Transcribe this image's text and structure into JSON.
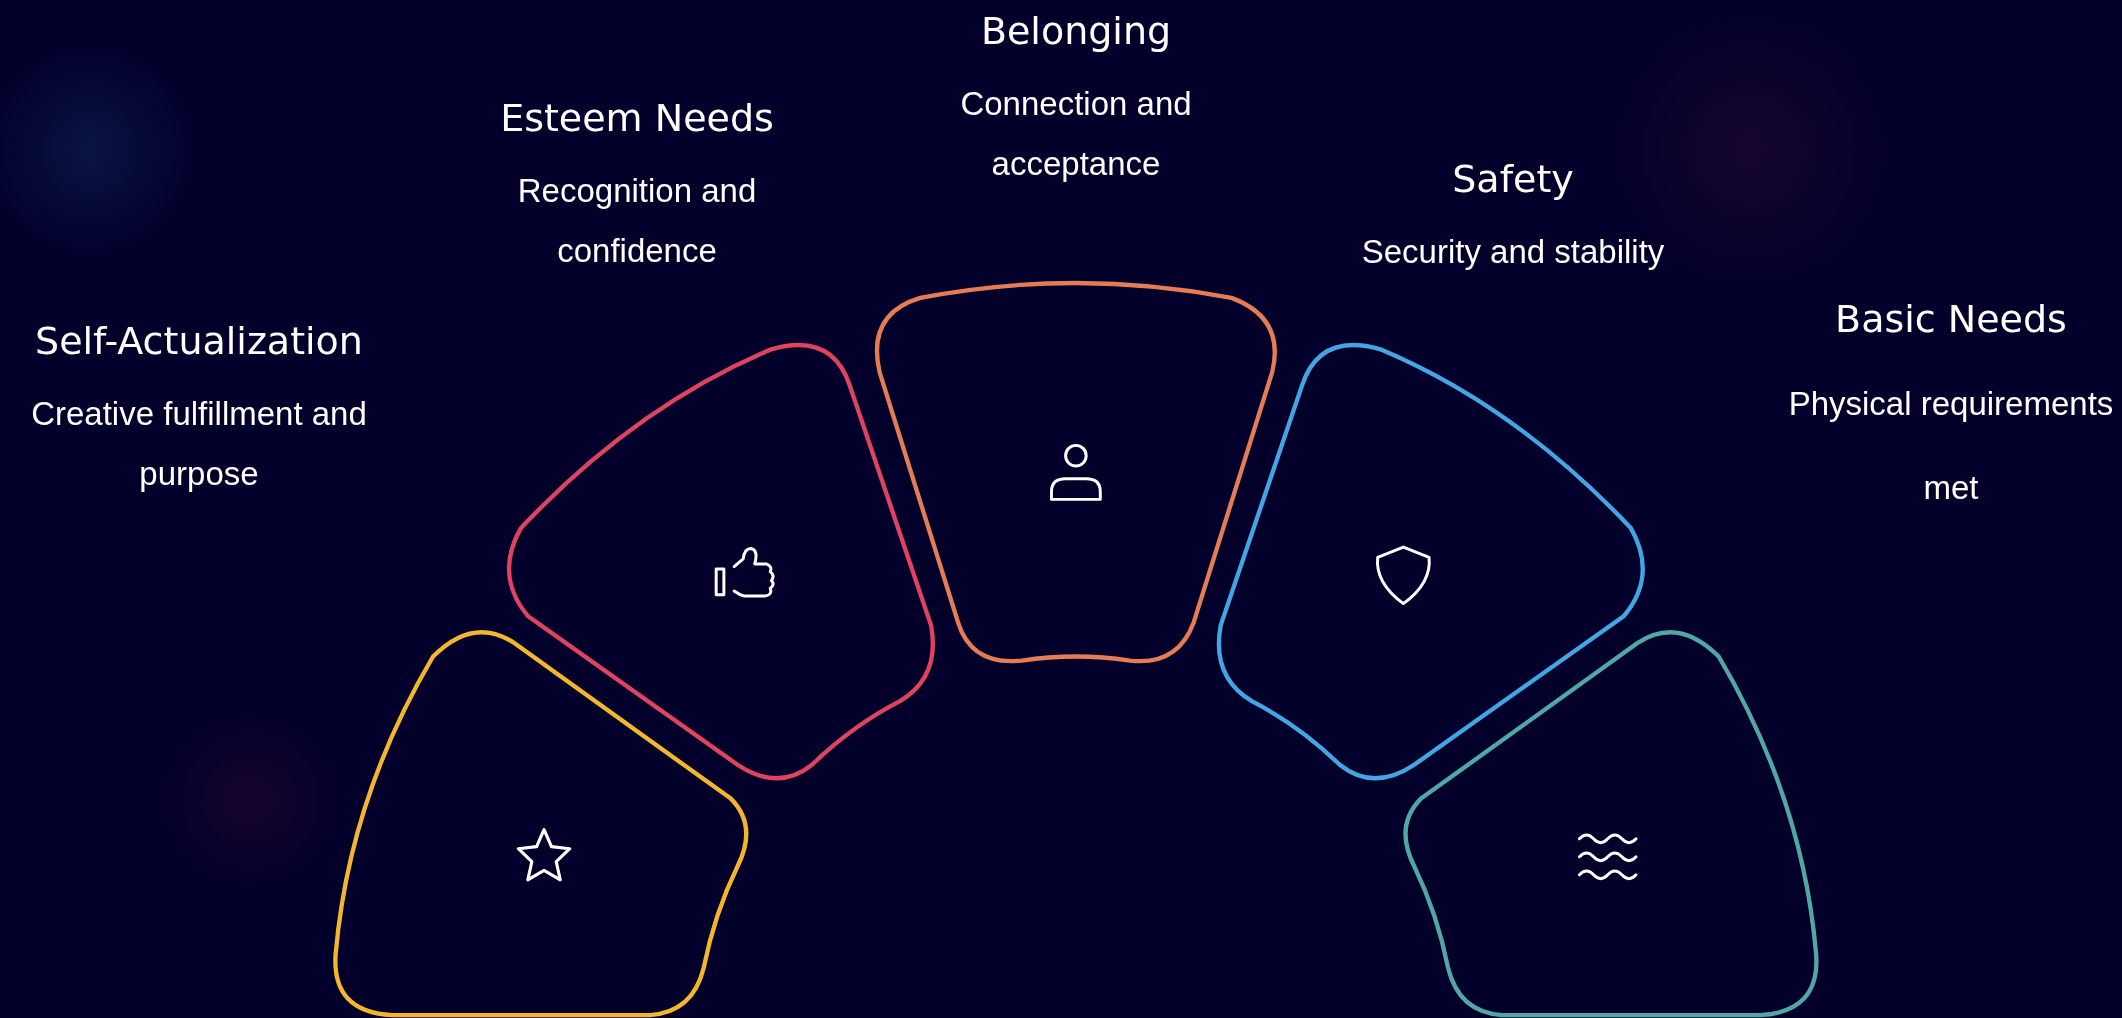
{
  "segments": [
    {
      "kind": "star",
      "title": "Self-Actualization",
      "description": "Creative fulfillment and purpose",
      "color": "#f4b62c"
    },
    {
      "kind": "thumb",
      "title": "Esteem Needs",
      "description": "Recognition and confidence",
      "color": "#e0435f"
    },
    {
      "kind": "person",
      "title": "Belonging",
      "description": "Connection and acceptance",
      "color": "#e57c55"
    },
    {
      "kind": "shield",
      "title": "Safety",
      "description": "Security and stability",
      "color": "#43a6e4"
    },
    {
      "kind": "waves",
      "title": "Basic Needs",
      "description": "Physical requirements met",
      "color": "#4fa8a4"
    }
  ]
}
